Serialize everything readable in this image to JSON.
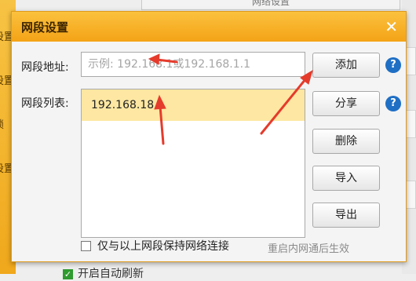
{
  "background": {
    "top_tab_label": "网络设置",
    "left_menu": [
      "设置",
      "设置",
      "锁",
      "设置"
    ],
    "bottom_option_label": "开启自动刷新"
  },
  "dialog": {
    "title": "网段设置",
    "close_glyph": "✕",
    "address_label": "网段地址:",
    "address_placeholder": "示例: 192.168.1或192.168.1.1",
    "list_label": "网段列表:",
    "list_items": [
      "192.168.18"
    ],
    "buttons": {
      "add": "添加",
      "share": "分享",
      "delete": "删除",
      "import": "导入",
      "export": "导出"
    },
    "help_glyph": "?",
    "keep_connection_label": "仅与以上网段保持网络连接",
    "restart_hint": "重启内网通后生效"
  },
  "colors": {
    "title_bar": "#f4a316",
    "selected_row": "#fde7a2",
    "arrow": "#e53b2c",
    "help_icon": "#1f6fc4"
  }
}
